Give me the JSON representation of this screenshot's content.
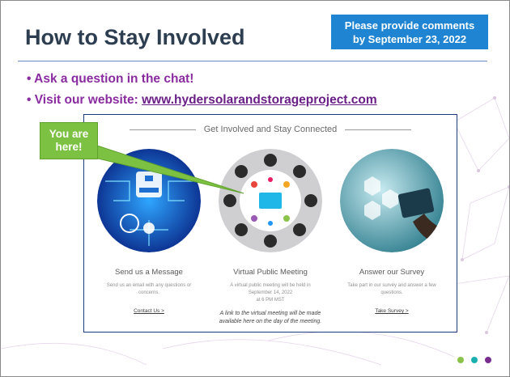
{
  "slide": {
    "title": "How to Stay Involved",
    "callout_line1": "Please provide comments",
    "callout_line2": "by September 23, 2022",
    "bullet1": "• Ask a question in the chat!",
    "bullet2_prefix": "• Visit our website: ",
    "bullet2_link": "www.hydersolarandstorageproject.com",
    "here_line1": "You are",
    "here_line2": "here!"
  },
  "website": {
    "header": "Get Involved and Stay Connected",
    "columns": [
      {
        "title": "Send us a Message",
        "desc": "Send us an email with any questions or concerns.",
        "link": "Contact Us  >"
      },
      {
        "title": "Virtual Public Meeting",
        "desc_line1": "A virtual public meeting will be held in",
        "desc_line2": "September 14, 2022",
        "desc_line3": "at 6 PM MST"
      },
      {
        "title": "Answer our Survey",
        "desc": "Take part in our survey and answer a few questions.",
        "link": "Take Survey  >"
      }
    ],
    "meeting_note": "A link to the virtual meeting will be made available here on the day of the meeting."
  },
  "colors": {
    "title": "#2c3e50",
    "callout": "#1f84d1",
    "bullets": "#8a2ca0",
    "here": "#7dc142",
    "dots": [
      "#8bc34a",
      "#1ab0b0",
      "#7b2c8f"
    ]
  },
  "icons": {
    "circle1": "network-circuit-icon",
    "circle2": "meeting-table-icon",
    "circle3": "survey-tablet-icon"
  }
}
